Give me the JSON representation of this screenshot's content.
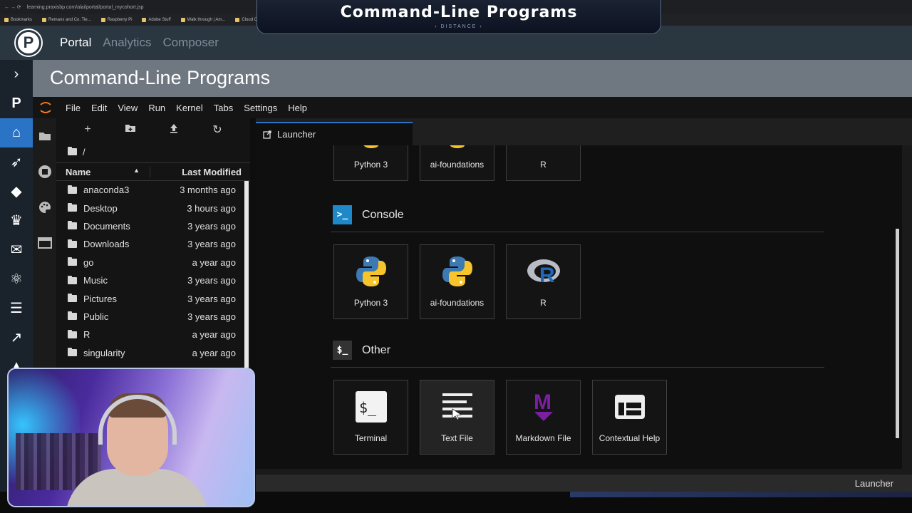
{
  "browser": {
    "url": "learning.praxisbp.com/alai/portal/portal_mycohort.jsp",
    "bookmarks": [
      "Bookmarks",
      "Remanx and Co. Tie...",
      "Raspberry Pi",
      "Adobe Stuff",
      "Walk through | Am...",
      "Cloud Com"
    ]
  },
  "overlay": {
    "title": "Command-Line Programs",
    "subtitle": "‹ DISTANCE ›"
  },
  "portal": {
    "logo": "P",
    "nav": [
      "Portal",
      "Analytics",
      "Composer"
    ]
  },
  "rail": {
    "items": [
      {
        "icon": "chevron-right-icon",
        "glyph": "›"
      },
      {
        "icon": "p-logo-icon",
        "glyph": "P"
      },
      {
        "icon": "cohort-icon",
        "glyph": "⌂"
      },
      {
        "icon": "rocket-icon",
        "glyph": "➶"
      },
      {
        "icon": "gitlab-icon",
        "glyph": "◆"
      },
      {
        "icon": "trophy-icon",
        "glyph": "♛"
      },
      {
        "icon": "mail-icon",
        "glyph": "✉"
      },
      {
        "icon": "atom-icon",
        "glyph": "⚛"
      },
      {
        "icon": "server-icon",
        "glyph": "☰"
      },
      {
        "icon": "chart-icon",
        "glyph": "↗"
      },
      {
        "icon": "graduation-icon",
        "glyph": "▲"
      }
    ]
  },
  "page": {
    "title": "Command-Line Programs"
  },
  "jupyter": {
    "menus": [
      "File",
      "Edit",
      "View",
      "Run",
      "Kernel",
      "Tabs",
      "Settings",
      "Help"
    ],
    "breadcrumb": "/",
    "columns": {
      "name": "Name",
      "modified": "Last Modified"
    },
    "files": [
      {
        "name": "anaconda3",
        "modified": "3 months ago"
      },
      {
        "name": "Desktop",
        "modified": "3 hours ago"
      },
      {
        "name": "Documents",
        "modified": "3 years ago"
      },
      {
        "name": "Downloads",
        "modified": "3 years ago"
      },
      {
        "name": "go",
        "modified": "a year ago"
      },
      {
        "name": "Music",
        "modified": "3 years ago"
      },
      {
        "name": "Pictures",
        "modified": "3 years ago"
      },
      {
        "name": "Public",
        "modified": "3 years ago"
      },
      {
        "name": "R",
        "modified": "a year ago"
      },
      {
        "name": "singularity",
        "modified": "a year ago"
      }
    ],
    "tab": "Launcher",
    "notebook_cards": [
      "Python 3",
      "ai-foundations",
      "R"
    ],
    "console": {
      "title": "Console",
      "cards": [
        "Python 3",
        "ai-foundations",
        "R"
      ]
    },
    "other": {
      "title": "Other",
      "cards": [
        "Terminal",
        "Text File",
        "Markdown File",
        "Contextual Help"
      ]
    },
    "status": "Launcher"
  },
  "colors": {
    "accent": "#2b74c5",
    "python_blue": "#3d7ab3",
    "python_yellow": "#f7c52b",
    "markdown_purple": "#7b1fa2",
    "jupyter_orange": "#f37726"
  }
}
